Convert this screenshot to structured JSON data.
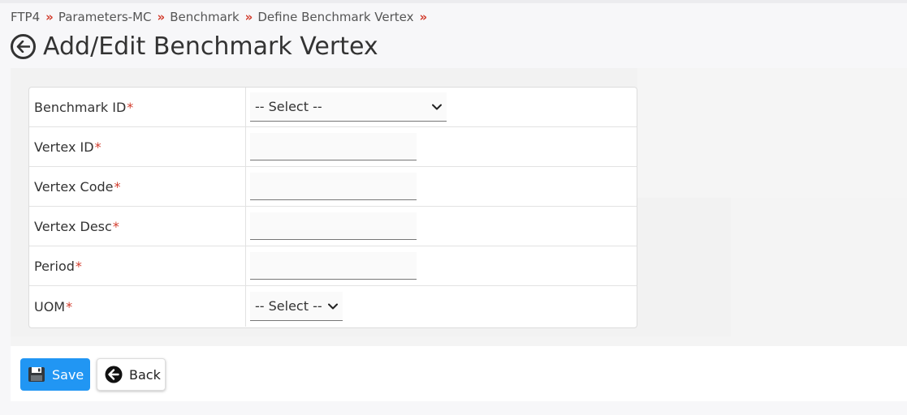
{
  "breadcrumb": {
    "items": [
      "FTP4",
      "Parameters-MC",
      "Benchmark",
      "Define Benchmark Vertex"
    ],
    "separator": "»"
  },
  "page": {
    "title": "Add/Edit Benchmark Vertex"
  },
  "form": {
    "required_marker": "*",
    "fields": [
      {
        "label": "Benchmark ID",
        "type": "select",
        "value": "-- Select --"
      },
      {
        "label": "Vertex ID",
        "type": "text",
        "value": ""
      },
      {
        "label": "Vertex Code",
        "type": "text",
        "value": ""
      },
      {
        "label": "Vertex Desc",
        "type": "text",
        "value": ""
      },
      {
        "label": "Period",
        "type": "text",
        "value": ""
      },
      {
        "label": "UOM",
        "type": "select",
        "value": "-- Select --"
      }
    ]
  },
  "actions": {
    "save_label": "Save",
    "back_label": "Back"
  },
  "colors": {
    "accent": "#2196f3",
    "breadcrumb_separator": "#d23b2b",
    "required": "#d23b2b"
  },
  "icons": {
    "title_back": "arrow-left-circle-icon",
    "save": "floppy-disk-icon",
    "back": "arrow-left-circle-filled-icon",
    "select": "chevron-down-icon"
  }
}
